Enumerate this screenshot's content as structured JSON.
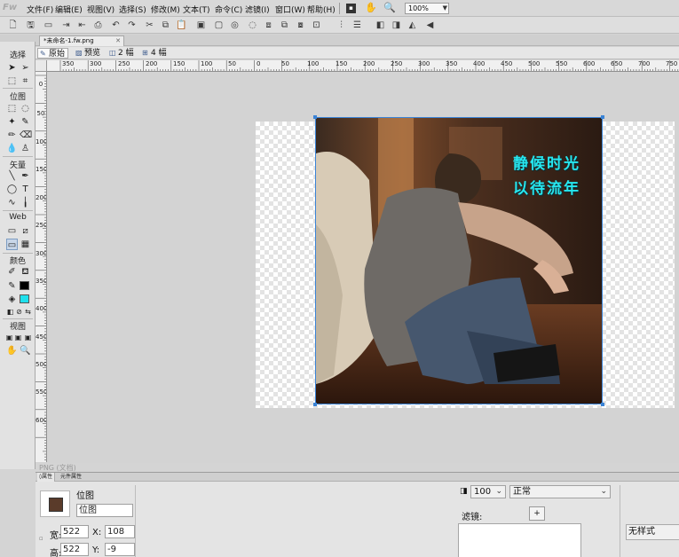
{
  "app": {
    "logo": "Fw"
  },
  "menu": [
    "文件(F)",
    "编辑(E)",
    "视图(V)",
    "选择(S)",
    "修改(M)",
    "文本(T)",
    "命令(C)",
    "滤镜(I)",
    "窗口(W)",
    "帮助(H)"
  ],
  "zoom": "100%",
  "document": {
    "tab_title": "*未命名-1.fw.png",
    "file_type_label": "PNG (文档)"
  },
  "view_modes": [
    "原始",
    "预览",
    "2 幅",
    "4 幅"
  ],
  "tools": {
    "select": "选择",
    "bitmap": "位图",
    "vector": "矢量",
    "web": "Web",
    "colors": "颜色",
    "view": "视图"
  },
  "ruler": {
    "top": [
      "350",
      "300",
      "250",
      "200",
      "150",
      "100",
      "50",
      "0",
      "50",
      "100",
      "150",
      "200",
      "250",
      "300",
      "350",
      "400",
      "450",
      "500",
      "550",
      "600",
      "650",
      "700",
      "750"
    ],
    "left": [
      "0",
      "50",
      "100",
      "150",
      "200",
      "250",
      "300",
      "350",
      "400",
      "450",
      "500",
      "550",
      "600"
    ]
  },
  "image_overlay": {
    "line1": "静候时光",
    "line2": "以待流年",
    "color": "#27e6ee"
  },
  "properties": {
    "tabs": [
      "属性",
      "元件属性"
    ],
    "object_type": "位图",
    "object_name": "位图",
    "width_label": "宽:",
    "width": "522",
    "height_label": "高:",
    "height": "522",
    "x_label": "X:",
    "x": "108",
    "y_label": "Y:",
    "y": "-9",
    "opacity": "100",
    "blend_mode": "正常",
    "filters_label": "滤镜:",
    "filter_add": "+",
    "style": "无样式"
  },
  "colors": {
    "accent": "#3a83d6",
    "fill_swatch": "#1fe0ec",
    "stroke_swatch": "#000000"
  }
}
